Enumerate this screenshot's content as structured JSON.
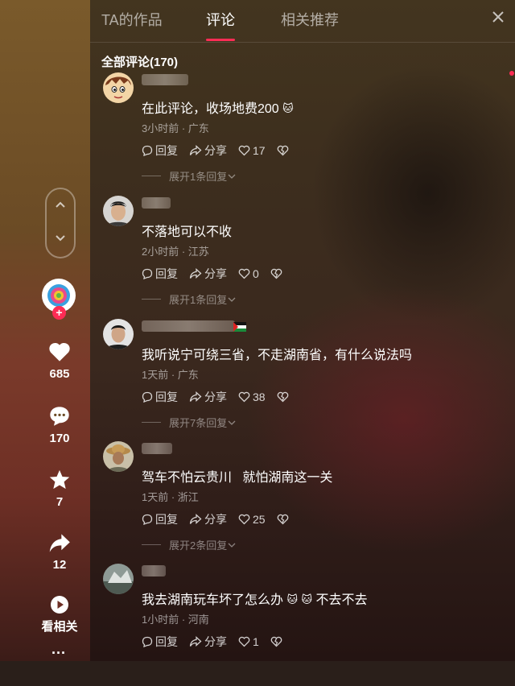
{
  "tabs": [
    {
      "label": "TA的作品"
    },
    {
      "label": "评论"
    },
    {
      "label": "相关推荐"
    }
  ],
  "total_comments": "全部评论(170)",
  "sidebar": {
    "likes": "685",
    "comments": "170",
    "favorites": "7",
    "shares": "12",
    "related": "看相关"
  },
  "comments": [
    {
      "text": "在此评论，收场地费200",
      "emoji": "🐱",
      "meta": "3小时前 · 广东",
      "reply": "回复",
      "share": "分享",
      "likes": "17",
      "expand": "展开1条回复"
    },
    {
      "text": "不落地可以不收",
      "emoji": "",
      "meta": "2小时前 · 江苏",
      "reply": "回复",
      "share": "分享",
      "likes": "0",
      "expand": "展开1条回复"
    },
    {
      "text": "我听说宁可绕三省，不走湖南省，有什么说法吗",
      "emoji": "",
      "meta": "1天前 · 广东",
      "reply": "回复",
      "share": "分享",
      "likes": "38",
      "expand": "展开7条回复"
    },
    {
      "text": "驾车不怕云贵川   就怕湖南这一关",
      "emoji": "",
      "meta": "1天前 · 浙江",
      "reply": "回复",
      "share": "分享",
      "likes": "25",
      "expand": "展开2条回复"
    },
    {
      "text_a": "我去湖南玩车坏了怎么办",
      "text_b": "不去不去",
      "meta": "1小时前 · 河南",
      "reply": "回复",
      "share": "分享",
      "likes": "1"
    }
  ],
  "colors": {
    "accent": "#fe2c55"
  }
}
